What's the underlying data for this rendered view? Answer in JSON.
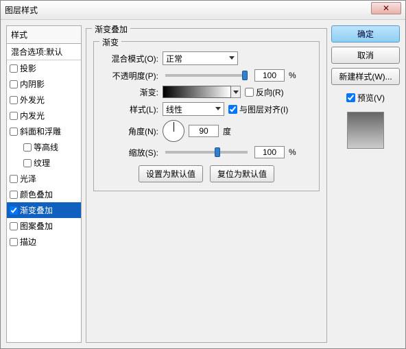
{
  "window": {
    "title": "图层样式",
    "close_glyph": "✕"
  },
  "left": {
    "header": "样式",
    "blend_options": "混合选项:默认",
    "items": [
      {
        "label": "投影",
        "checked": false
      },
      {
        "label": "内阴影",
        "checked": false
      },
      {
        "label": "外发光",
        "checked": false
      },
      {
        "label": "内发光",
        "checked": false
      },
      {
        "label": "斜面和浮雕",
        "checked": false
      },
      {
        "label": "等高线",
        "checked": false,
        "indent": true
      },
      {
        "label": "纹理",
        "checked": false,
        "indent": true
      },
      {
        "label": "光泽",
        "checked": false
      },
      {
        "label": "颜色叠加",
        "checked": false
      },
      {
        "label": "渐变叠加",
        "checked": true,
        "selected": true
      },
      {
        "label": "图案叠加",
        "checked": false
      },
      {
        "label": "描边",
        "checked": false
      }
    ]
  },
  "middle": {
    "group_title": "渐变叠加",
    "inner_title": "渐变",
    "blend_mode_label": "混合模式(O):",
    "blend_mode_value": "正常",
    "opacity_label": "不透明度(P):",
    "opacity_value": "100",
    "opacity_unit": "%",
    "gradient_label": "渐变:",
    "reverse_label": "反向(R)",
    "style_label": "样式(L):",
    "style_value": "线性",
    "align_label": "与图层对齐(I)",
    "angle_label": "角度(N):",
    "angle_value": "90",
    "angle_unit": "度",
    "scale_label": "缩放(S):",
    "scale_value": "100",
    "scale_unit": "%",
    "btn_default": "设置为默认值",
    "btn_reset": "复位为默认值"
  },
  "right": {
    "ok": "确定",
    "cancel": "取消",
    "new_style": "新建样式(W)...",
    "preview_label": "预览(V)"
  }
}
